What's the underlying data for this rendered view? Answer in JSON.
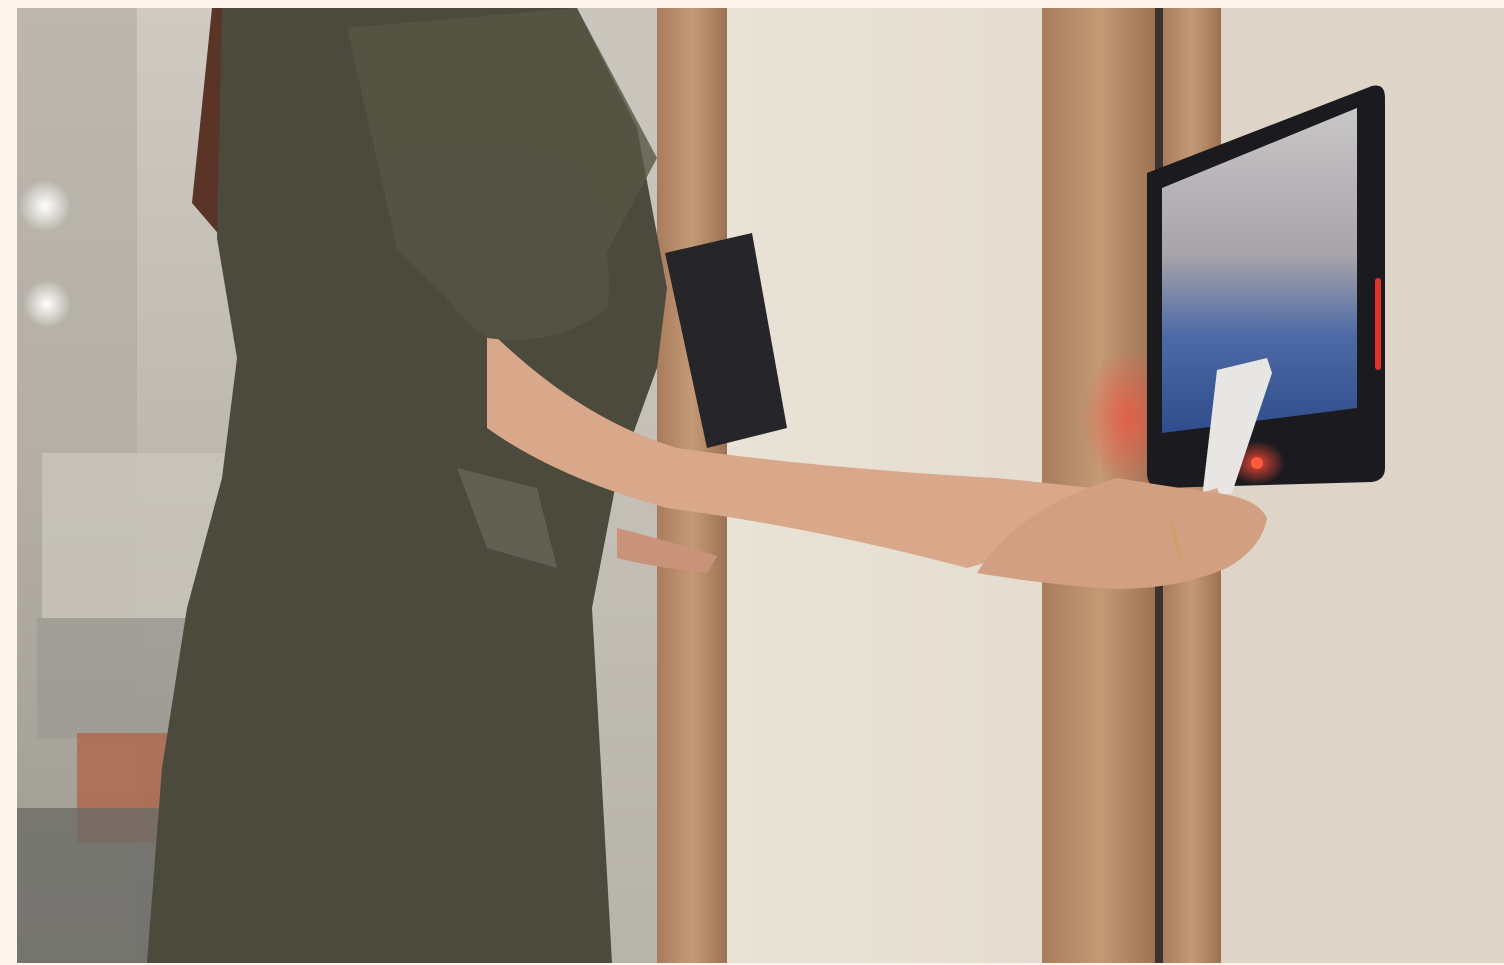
{
  "photo": {
    "subject": "access-control-scene",
    "colors": {
      "page_background": "#fdf5ee",
      "wall": "#e3dbcf",
      "wood_frame": "#b88a66",
      "jumpsuit": "#4b4a3d",
      "skin": "#d9a88a",
      "tablet_body": "#1b1b1f",
      "status_light": "#e5322a"
    }
  }
}
